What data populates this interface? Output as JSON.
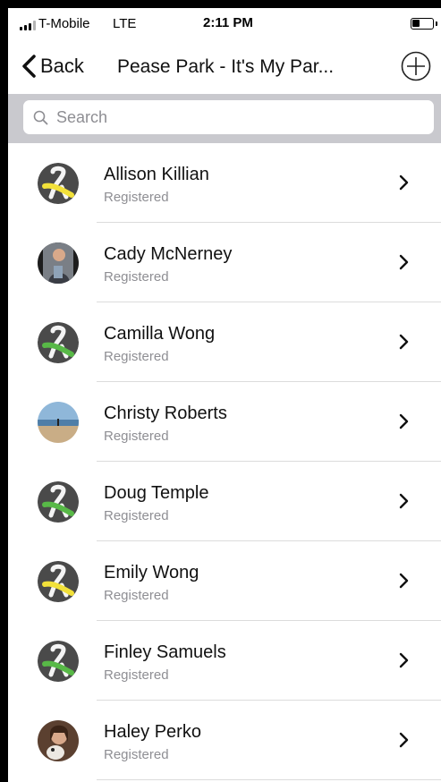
{
  "status_bar": {
    "carrier": "T-Mobile",
    "network": "LTE",
    "time": "2:11 PM",
    "battery_level": 0.4
  },
  "nav": {
    "back_label": "Back",
    "title": "Pease Park - It's My Par...",
    "back_icon": "chevron-left-icon",
    "add_icon": "plus-circle-icon"
  },
  "search": {
    "placeholder": "Search",
    "value": ""
  },
  "contacts": [
    {
      "name": "Allison Killian",
      "status": "Registered",
      "avatar": "ribbon-yellow"
    },
    {
      "name": "Cady McNerney",
      "status": "Registered",
      "avatar": "photo-person"
    },
    {
      "name": "Camilla Wong",
      "status": "Registered",
      "avatar": "ribbon-green"
    },
    {
      "name": "Christy Roberts",
      "status": "Registered",
      "avatar": "photo-beach"
    },
    {
      "name": "Doug Temple",
      "status": "Registered",
      "avatar": "ribbon-green"
    },
    {
      "name": "Emily Wong",
      "status": "Registered",
      "avatar": "ribbon-yellow"
    },
    {
      "name": "Finley Samuels",
      "status": "Registered",
      "avatar": "ribbon-green"
    },
    {
      "name": "Haley Perko",
      "status": "Registered",
      "avatar": "photo-woman"
    }
  ],
  "colors": {
    "ribbon_green": "#58b947",
    "ribbon_yellow": "#f2e13a",
    "avatar_bg": "#4a4a4a",
    "search_bar_bg": "#c9c9ce"
  }
}
